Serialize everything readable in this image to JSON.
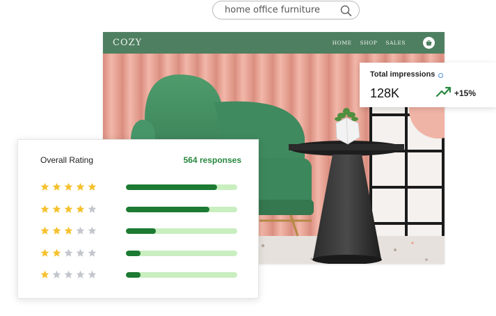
{
  "search": {
    "value": "home office furniture"
  },
  "site": {
    "brand": "COZY",
    "nav": [
      "HOME",
      "SHOP",
      "SALES"
    ]
  },
  "impressions": {
    "title": "Total impressions",
    "value": "128K",
    "change": "+15%"
  },
  "rating": {
    "title": "Overall Rating",
    "responses": "564 responses",
    "rows": [
      {
        "stars": 5,
        "fill": 0.82
      },
      {
        "stars": 4,
        "fill": 0.75
      },
      {
        "stars": 3,
        "fill": 0.27
      },
      {
        "stars": 2,
        "fill": 0.13
      },
      {
        "stars": 1,
        "fill": 0.13
      }
    ]
  },
  "colors": {
    "brand_green": "#4f7f61",
    "accent_green": "#27883e",
    "bar_fill": "#1c7a32",
    "bar_track": "#c9eec0",
    "star_on": "#f5c12e",
    "star_off": "#c3c6cc"
  }
}
